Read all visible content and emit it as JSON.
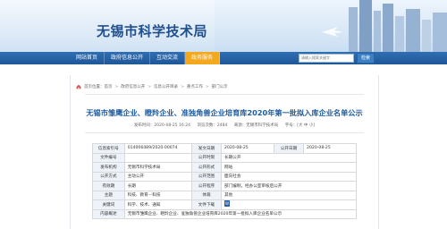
{
  "site": {
    "title": "无锡市科学技术局"
  },
  "nav": {
    "items": [
      "网站首页",
      "政府信息公开",
      "互动交流",
      "政务服务"
    ],
    "active_index": 3,
    "search_placeholder": "请输入搜索关键字",
    "search_button": "检索"
  },
  "breadcrumb": [
    "首页位置：首页",
    "政府信息公开",
    "信息公开目录",
    "重点工作",
    "部门公示"
  ],
  "article": {
    "title": "无锡市雏鹰企业、瞪羚企业、准独角兽企业培育库2020年第一批拟入库企业名单公示",
    "meta": {
      "date": "发布时间：2020-08-25 16:24",
      "views": "浏览次数：2484",
      "source": "来源：无锡市科学技术局",
      "font": "字号：[大 中 小]"
    }
  },
  "info_table": {
    "rows": [
      [
        {
          "k": "信息索引号"
        },
        {
          "v": "014006489/2020-00074"
        },
        {
          "k": "发文日期"
        },
        {
          "v": "2020-08-25"
        },
        {
          "k": "公开日期"
        },
        {
          "v": "2020-08-25"
        }
      ],
      [
        {
          "k": "文件编号"
        },
        {
          "v": ""
        },
        {
          "k": "公开时限"
        },
        {
          "v": "长期公开"
        },
        {
          "k": ""
        },
        {
          "v": ""
        }
      ],
      [
        {
          "k": "发布机构"
        },
        {
          "v": "无锡市科学技术局"
        },
        {
          "k": "公开形式"
        },
        {
          "v": "网站"
        },
        {
          "k": ""
        },
        {
          "v": ""
        }
      ],
      [
        {
          "k": "公开方式"
        },
        {
          "v": "主动公开"
        },
        {
          "k": "公开范围"
        },
        {
          "v": "面向社会"
        },
        {
          "k": ""
        },
        {
          "v": ""
        }
      ],
      [
        {
          "k": "有效期"
        },
        {
          "v": "长期"
        },
        {
          "k": "公开程序"
        },
        {
          "v": "部门编制，经办公室审核后公开"
        },
        {
          "k": ""
        },
        {
          "v": ""
        }
      ],
      [
        {
          "k": "主题"
        },
        {
          "v": "科技、教育－科技"
        },
        {
          "k": "体裁"
        },
        {
          "v": "其他"
        },
        {
          "k": ""
        },
        {
          "v": ""
        }
      ],
      [
        {
          "k": "关键词"
        },
        {
          "v": "科学、技术、通知"
        },
        {
          "k": "文件下载"
        },
        {
          "v": ""
        },
        {
          "k": ""
        },
        {
          "v": ""
        }
      ]
    ],
    "summary_label": "内容概述",
    "summary": "无锡市雏鹰企业、瞪羚企业、准独角兽企业培育库2020年第一批拟入库企业名单公示"
  },
  "colors": {
    "nav_blue": "#2f6fb3",
    "active_orange": "#f4a81d",
    "title_blue": "#1f5da0",
    "label_bg": "#eef3f9"
  },
  "icons": [
    "home-icon",
    "word-doc-icon"
  ]
}
